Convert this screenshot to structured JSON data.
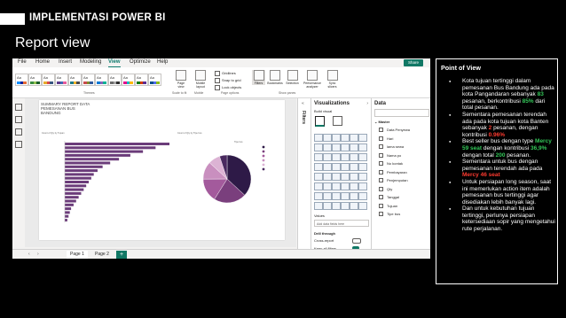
{
  "slide": {
    "header_title": "IMPLEMENTASI POWER BI",
    "subtitle": "Report view"
  },
  "pbi": {
    "menu": [
      "File",
      "Home",
      "Insert",
      "Modeling",
      "View",
      "Optimize",
      "Help"
    ],
    "active_menu": "View",
    "share_label": "Share",
    "ribbon": {
      "themes_caption": "Themes",
      "theme_swatch_label": "Aa",
      "page_view": "Page view",
      "scale_caption": "Scale to fit",
      "mobile_layout": "Mobile layout",
      "mobile_caption": "Mobile",
      "gridlines": "Gridlines",
      "snap_to_grid": "Snap to grid",
      "lock_objects": "Lock objects",
      "page_options_caption": "Page options",
      "show_panes": [
        "Filters",
        "Bookmarks",
        "Selection",
        "Performance analyzer",
        "Sync slicers"
      ],
      "show_panes_caption": "Show panes"
    },
    "report": {
      "title_lines": [
        "SUMMARY REPORT DATA",
        "PEMESANAN BUS",
        "BANDUNG"
      ],
      "bar_chart_title": "Count of Qty by Tujuan",
      "pie_chart_title": "Count of Qty by Tipe bus",
      "pie_legend_title": "Tipe bus"
    },
    "filters_label": "Filters",
    "visualizations": {
      "title": "Visualizations",
      "build_visual": "Build visual",
      "values_label": "Values",
      "add_fields": "Add data fields here",
      "drill_through": "Drill through",
      "cross_report": "Cross-report",
      "keep_all_filters": "Keep all filters"
    },
    "data_pane": {
      "title": "Data",
      "table": "Master",
      "fields": [
        "Data Penyewa",
        "Hari",
        "lama sewa",
        "Nama po",
        "No kontak",
        "Pembayaran",
        "Penjemputan",
        "Qty",
        "Tanggal",
        "Tujuan",
        "Tipe bus"
      ]
    },
    "pages": [
      "Page 1",
      "Page 2"
    ],
    "add_page": "+"
  },
  "pov": {
    "title": "Point of View",
    "items": [
      {
        "parts": [
          {
            "t": "Kota tujuan tertinggi dalam pemesanan Bus Bandung ada pada kota Pangandaran sebanyak "
          },
          {
            "t": "83",
            "c": "green"
          },
          {
            "t": " pesanan, berkontribusi "
          },
          {
            "t": "85%",
            "c": "green"
          },
          {
            "t": " dari total pesanan."
          }
        ]
      },
      {
        "parts": [
          {
            "t": "Sementara pemesanan terendah ada pada kota tujuan kota Banten sebanyak "
          },
          {
            "t": "2",
            "c": "red"
          },
          {
            "t": " pesanan, dengan kontribusi "
          },
          {
            "t": "0.96%",
            "c": "red"
          }
        ]
      },
      {
        "parts": [
          {
            "t": "Best seller bus dengan type "
          },
          {
            "t": "Mercy 59 seat",
            "c": "green"
          },
          {
            "t": " dengan kontribusi "
          },
          {
            "t": "36,9%",
            "c": "green"
          },
          {
            "t": " dengan total "
          },
          {
            "t": "200",
            "c": "green"
          },
          {
            "t": " pesanan."
          }
        ]
      },
      {
        "parts": [
          {
            "t": "Sementara untuk bus dengan pemesanan terendah ada pada "
          },
          {
            "t": "Mercy 46 seat",
            "c": "red"
          }
        ]
      },
      {
        "parts": [
          {
            "t": "Untuk persiapan long season, saat ini memerlukan action item adalah pemesanan bus tertinggi agar disediakan lebih banyak lagi."
          }
        ]
      },
      {
        "parts": [
          {
            "t": "Dan untuk kebutuhan tujuan tertinggi, perlunya persiapan ketersediaan sopir yang mengetahui rute perjalanan."
          }
        ]
      }
    ]
  },
  "colors": {
    "accent": "#117865",
    "bar": "#6b3c7a",
    "pie": [
      "#2e1a47",
      "#7a3f7d",
      "#a35a9c",
      "#c98fbf",
      "#dcb3d4",
      "#4a2a60"
    ]
  },
  "chart_data": [
    {
      "type": "bar",
      "title": "Count of Qty by Tujuan",
      "orientation": "horizontal",
      "values": [
        83,
        72,
        62,
        52,
        43,
        36,
        30,
        26,
        23,
        21,
        19,
        17,
        15,
        13,
        11,
        9,
        7,
        5,
        4,
        3,
        2
      ]
    },
    {
      "type": "pie",
      "title": "Count of Qty by Tipe bus",
      "values": [
        36.9,
        22,
        16,
        12,
        8,
        5.1
      ]
    }
  ]
}
